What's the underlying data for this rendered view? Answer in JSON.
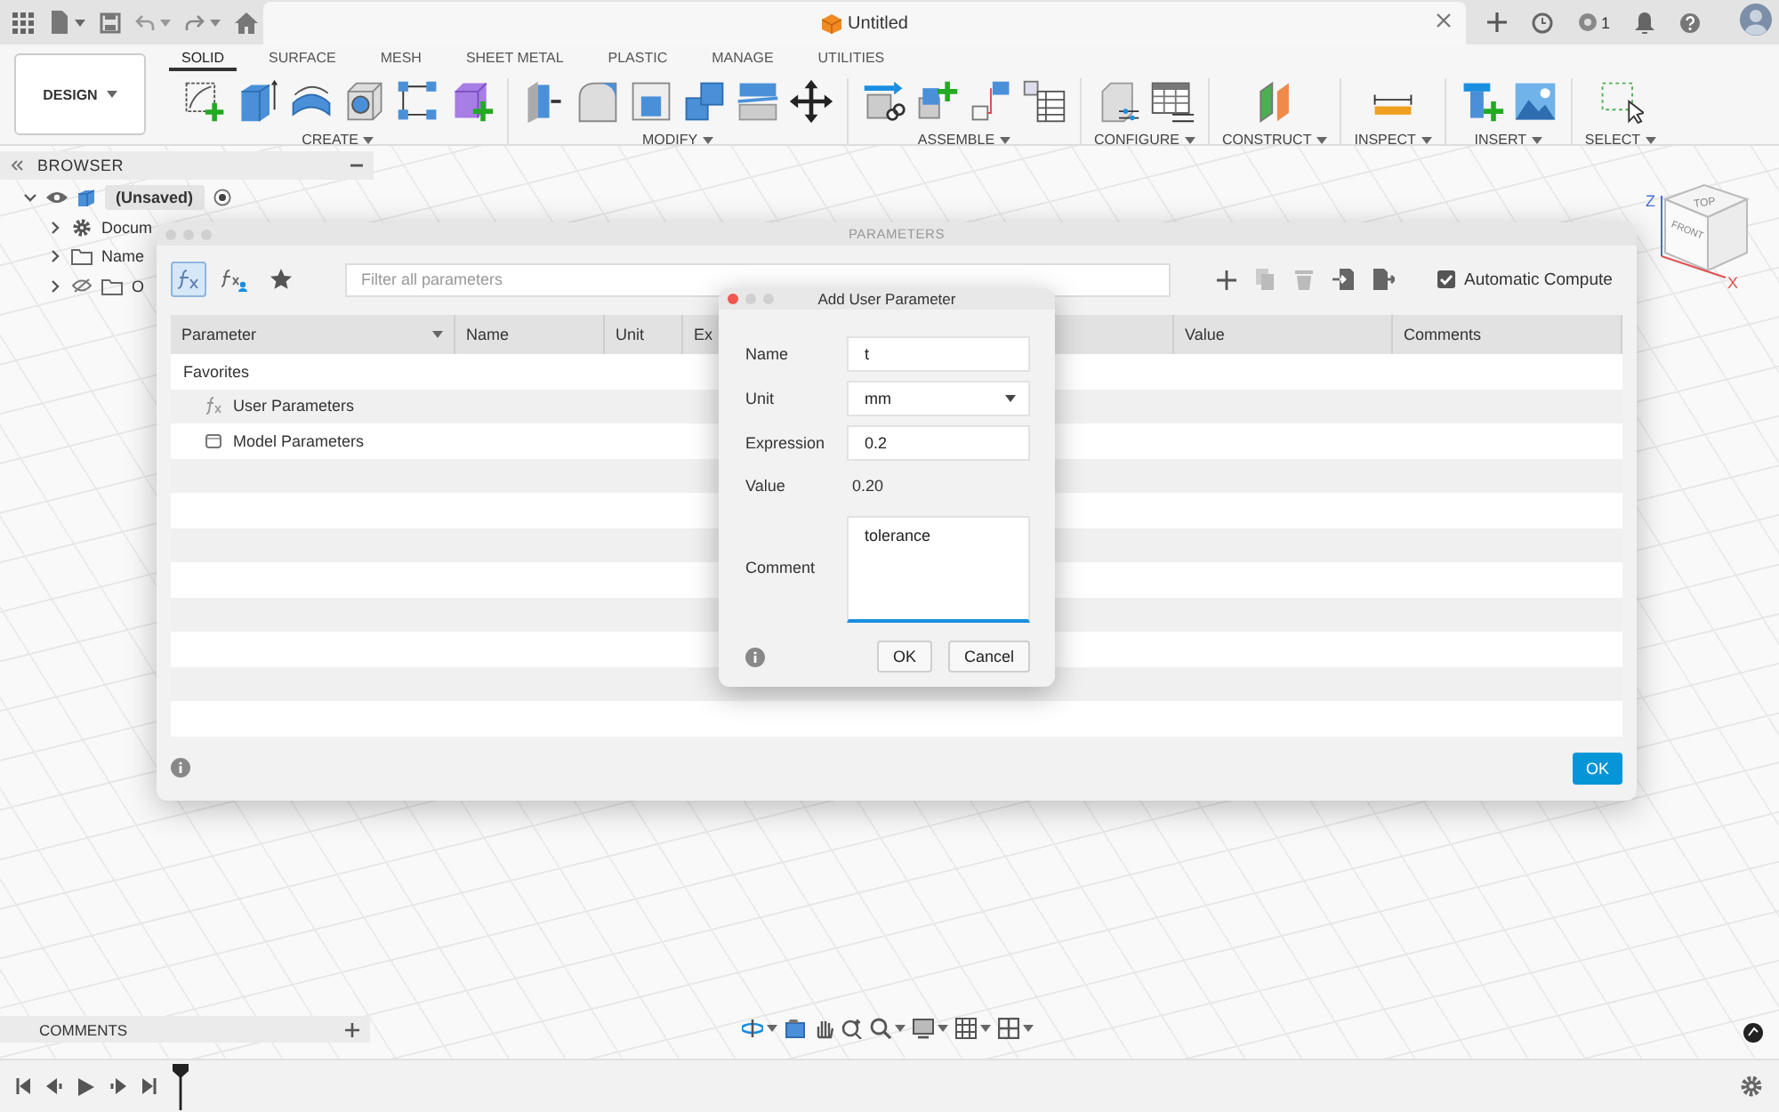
{
  "top_bar": {
    "document_title": "Untitled",
    "job_count": "1"
  },
  "workspace_button": {
    "label": "DESIGN"
  },
  "tabs": [
    {
      "label": "SOLID",
      "selected": true
    },
    {
      "label": "SURFACE",
      "selected": false
    },
    {
      "label": "MESH",
      "selected": false
    },
    {
      "label": "SHEET METAL",
      "selected": false
    },
    {
      "label": "PLASTIC",
      "selected": false
    },
    {
      "label": "MANAGE",
      "selected": false
    },
    {
      "label": "UTILITIES",
      "selected": false
    }
  ],
  "tool_groups": [
    {
      "label": "CREATE"
    },
    {
      "label": "MODIFY"
    },
    {
      "label": "ASSEMBLE"
    },
    {
      "label": "CONFIGURE"
    },
    {
      "label": "CONSTRUCT"
    },
    {
      "label": "INSPECT"
    },
    {
      "label": "INSERT"
    },
    {
      "label": "SELECT"
    }
  ],
  "browser": {
    "title": "BROWSER",
    "root": {
      "label": "(Unsaved)",
      "expanded": true,
      "children": [
        {
          "label": "Docum",
          "expanded": false
        },
        {
          "label": "Name",
          "expanded": false
        },
        {
          "label": "O",
          "expanded": false
        }
      ]
    }
  },
  "parameters": {
    "title": "PARAMETERS",
    "view_filters": [
      {
        "selected": true
      },
      {
        "selected": false
      },
      {
        "selected": false
      }
    ],
    "filter": {
      "placeholder": "Filter all parameters"
    },
    "automatic_compute": {
      "label": "Automatic Compute",
      "checked": true
    },
    "columns": [
      "Parameter",
      "Name",
      "Unit",
      "Ex",
      "Value",
      "Comments"
    ],
    "rows": [
      {
        "label": "Favorites"
      },
      {
        "label": "User Parameters"
      },
      {
        "label": "Model Parameters"
      }
    ],
    "ok_button": "OK"
  },
  "add_user_parameter": {
    "title": "Add User Parameter",
    "fields": [
      {
        "label": "Name",
        "kind": "text",
        "value": "t"
      },
      {
        "label": "Unit",
        "kind": "select",
        "value": "mm"
      },
      {
        "label": "Expression",
        "kind": "text",
        "value": "0.2"
      },
      {
        "label": "Value",
        "kind": "readout",
        "value": "0.20"
      },
      {
        "label": "Comment",
        "kind": "textarea",
        "value": "tolerance"
      }
    ],
    "buttons": [
      "OK",
      "Cancel"
    ]
  },
  "view_cube": {
    "faces": [
      "TOP",
      "FRONT"
    ],
    "axes": [
      "Z",
      "X"
    ]
  },
  "comments": {
    "title": "COMMENTS"
  }
}
